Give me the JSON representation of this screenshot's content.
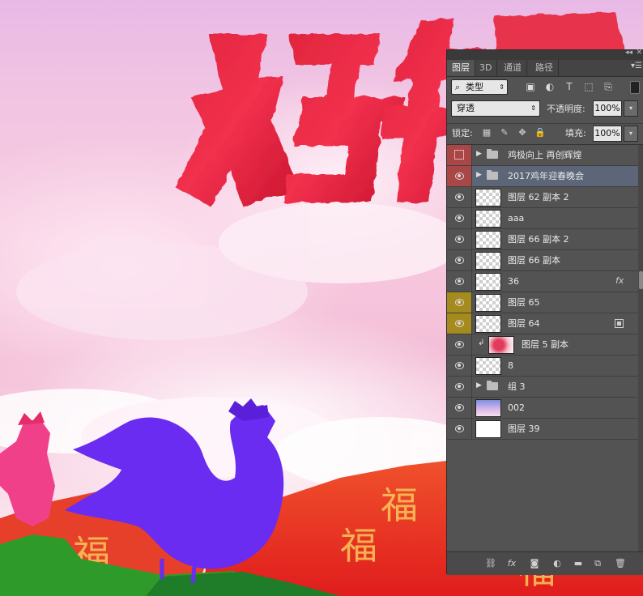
{
  "canvas": {
    "headline_text": "鸡年",
    "banner_glyphs": [
      "福",
      "福",
      "福",
      "福"
    ]
  },
  "panel": {
    "topbar": {
      "collapse": "◂◂",
      "close": "✕"
    },
    "tabs": [
      {
        "label": "图层",
        "active": true
      },
      {
        "label": "3D",
        "active": false
      },
      {
        "label": "通道",
        "active": false
      },
      {
        "label": "路径",
        "active": false
      }
    ],
    "filter": {
      "kind_label": "类型"
    },
    "blend_mode": "穿透",
    "opacity_label": "不透明度:",
    "opacity_value": "100%",
    "lock_label": "锁定:",
    "fill_label": "填充:",
    "fill_value": "100%",
    "layers": [
      {
        "name": "鸡极向上 再创辉煌",
        "type": "group",
        "eye": "red-hidden"
      },
      {
        "name": "2017鸡年迎春晚会",
        "type": "group",
        "eye": "red",
        "selected": true
      },
      {
        "name": "图层 62 副本 2",
        "type": "layer",
        "eye": "visible"
      },
      {
        "name": "aaa",
        "type": "layer",
        "eye": "visible"
      },
      {
        "name": "图层 66 副本 2",
        "type": "layer",
        "eye": "visible"
      },
      {
        "name": "图层 66 副本",
        "type": "layer",
        "eye": "visible"
      },
      {
        "name": "36",
        "type": "layer",
        "eye": "visible",
        "badge": "fx"
      },
      {
        "name": "图层 65",
        "type": "layer",
        "eye": "yellow"
      },
      {
        "name": "图层 64",
        "type": "layer",
        "eye": "yellow",
        "badge": "smart"
      },
      {
        "name": "图层 5 副本",
        "type": "clipped",
        "eye": "visible"
      },
      {
        "name": "8",
        "type": "layer",
        "eye": "visible"
      },
      {
        "name": "组 3",
        "type": "group",
        "eye": "visible"
      },
      {
        "name": "002",
        "type": "layer",
        "eye": "visible",
        "thumb": "sky"
      },
      {
        "name": "图层 39",
        "type": "layer",
        "eye": "visible",
        "thumb": "white"
      }
    ]
  }
}
